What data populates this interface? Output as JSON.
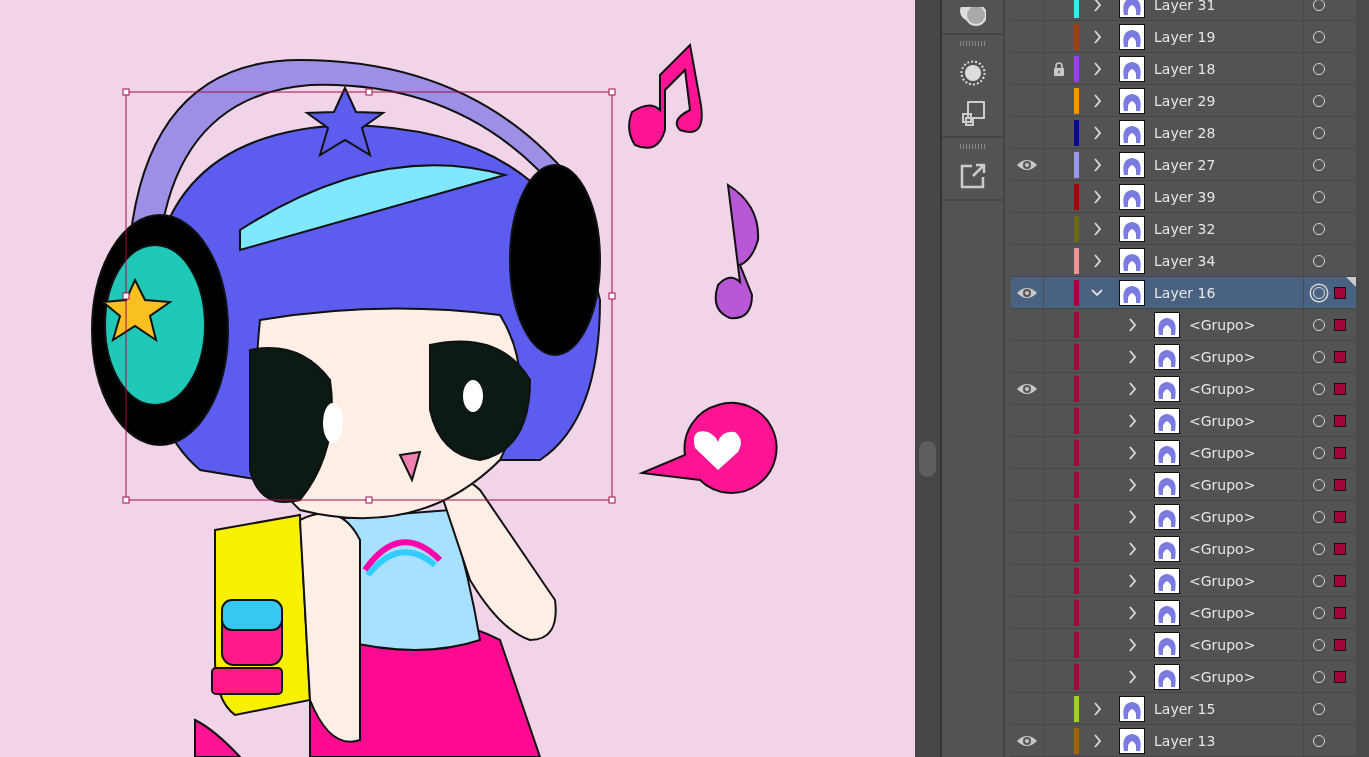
{
  "layers": [
    {
      "name": "Layer 31",
      "color": "#3ee6ee",
      "visible": false,
      "expanded": false,
      "selected": false,
      "targeted": false
    },
    {
      "name": "Layer 19",
      "color": "#a3400c",
      "visible": false,
      "expanded": false,
      "selected": false,
      "targeted": false
    },
    {
      "name": "Layer 18",
      "color": "#9a3ef2",
      "visible": false,
      "locked": true,
      "expanded": false,
      "selected": false,
      "targeted": false
    },
    {
      "name": "Layer 29",
      "color": "#ff9400",
      "visible": false,
      "expanded": false,
      "selected": false,
      "targeted": false
    },
    {
      "name": "Layer 28",
      "color": "#0a0a90",
      "visible": false,
      "expanded": false,
      "selected": false,
      "targeted": false
    },
    {
      "name": "Layer 27",
      "color": "#9898f2",
      "visible": true,
      "expanded": false,
      "selected": false,
      "targeted": false
    },
    {
      "name": "Layer 39",
      "color": "#a40606",
      "visible": false,
      "expanded": false,
      "selected": false,
      "targeted": false
    },
    {
      "name": "Layer 32",
      "color": "#6e6c12",
      "visible": false,
      "expanded": false,
      "selected": false,
      "targeted": false
    },
    {
      "name": "Layer 34",
      "color": "#f09494",
      "visible": false,
      "expanded": false,
      "selected": false,
      "targeted": false
    },
    {
      "name": "Layer 16",
      "color": "#a0063c",
      "visible": true,
      "expanded": true,
      "selected": true,
      "targeted": true,
      "has_selection": true,
      "children": [
        {
          "name": "<Grupo>",
          "visible": false,
          "has_selection": true
        },
        {
          "name": "<Grupo>",
          "visible": false,
          "has_selection": true
        },
        {
          "name": "<Grupo>",
          "visible": true,
          "has_selection": true
        },
        {
          "name": "<Grupo>",
          "visible": false,
          "has_selection": true
        },
        {
          "name": "<Grupo>",
          "visible": false,
          "has_selection": true
        },
        {
          "name": "<Grupo>",
          "visible": false,
          "has_selection": true
        },
        {
          "name": "<Grupo>",
          "visible": false,
          "has_selection": true
        },
        {
          "name": "<Grupo>",
          "visible": false,
          "has_selection": true
        },
        {
          "name": "<Grupo>",
          "visible": false,
          "has_selection": true
        },
        {
          "name": "<Grupo>",
          "visible": false,
          "has_selection": true
        },
        {
          "name": "<Grupo>",
          "visible": false,
          "has_selection": true
        },
        {
          "name": "<Grupo>",
          "visible": false,
          "has_selection": true
        }
      ]
    },
    {
      "name": "Layer 15",
      "color": "#a2d41e",
      "visible": false,
      "expanded": false,
      "selected": false,
      "targeted": false
    },
    {
      "name": "Layer 13",
      "color": "#a06204",
      "visible": true,
      "expanded": false,
      "selected": false,
      "targeted": false
    }
  ]
}
